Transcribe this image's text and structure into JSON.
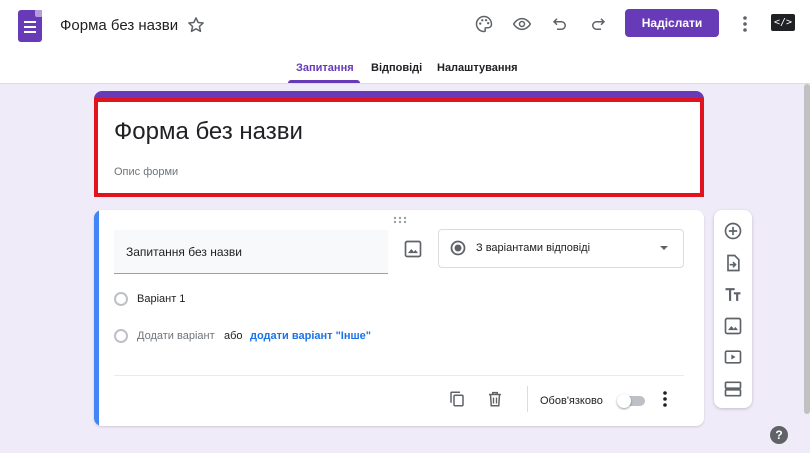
{
  "header": {
    "doc_title": "Форма без назви",
    "send_label": "Надіслати",
    "embed_label": "</>"
  },
  "tabs": [
    {
      "label": "Запитання",
      "active": true
    },
    {
      "label": "Відповіді",
      "active": false
    },
    {
      "label": "Налаштування",
      "active": false
    }
  ],
  "form": {
    "title": "Форма без назви",
    "description_placeholder": "Опис форми"
  },
  "question": {
    "title": "Запитання без назви",
    "type": "З варіантами відповіді",
    "options": [
      "Варіант 1"
    ],
    "add_option": "Додати варіант",
    "or": "або",
    "add_other": "додати варіант \"Інше\"",
    "required_label": "Обов'язково",
    "required": false
  },
  "help": "?",
  "colors": {
    "brand": "#673ab7",
    "accent": "#4285f4",
    "link": "#1a73e8",
    "highlight": "#e0131f",
    "background": "#f0ebf8"
  },
  "icons": {
    "header": [
      "palette-icon",
      "eye-icon",
      "undo-icon",
      "redo-icon",
      "more-vert-icon"
    ],
    "sidebar": [
      "add-circle-icon",
      "import-icon",
      "title-text-icon",
      "image-icon",
      "video-icon",
      "section-icon"
    ]
  }
}
